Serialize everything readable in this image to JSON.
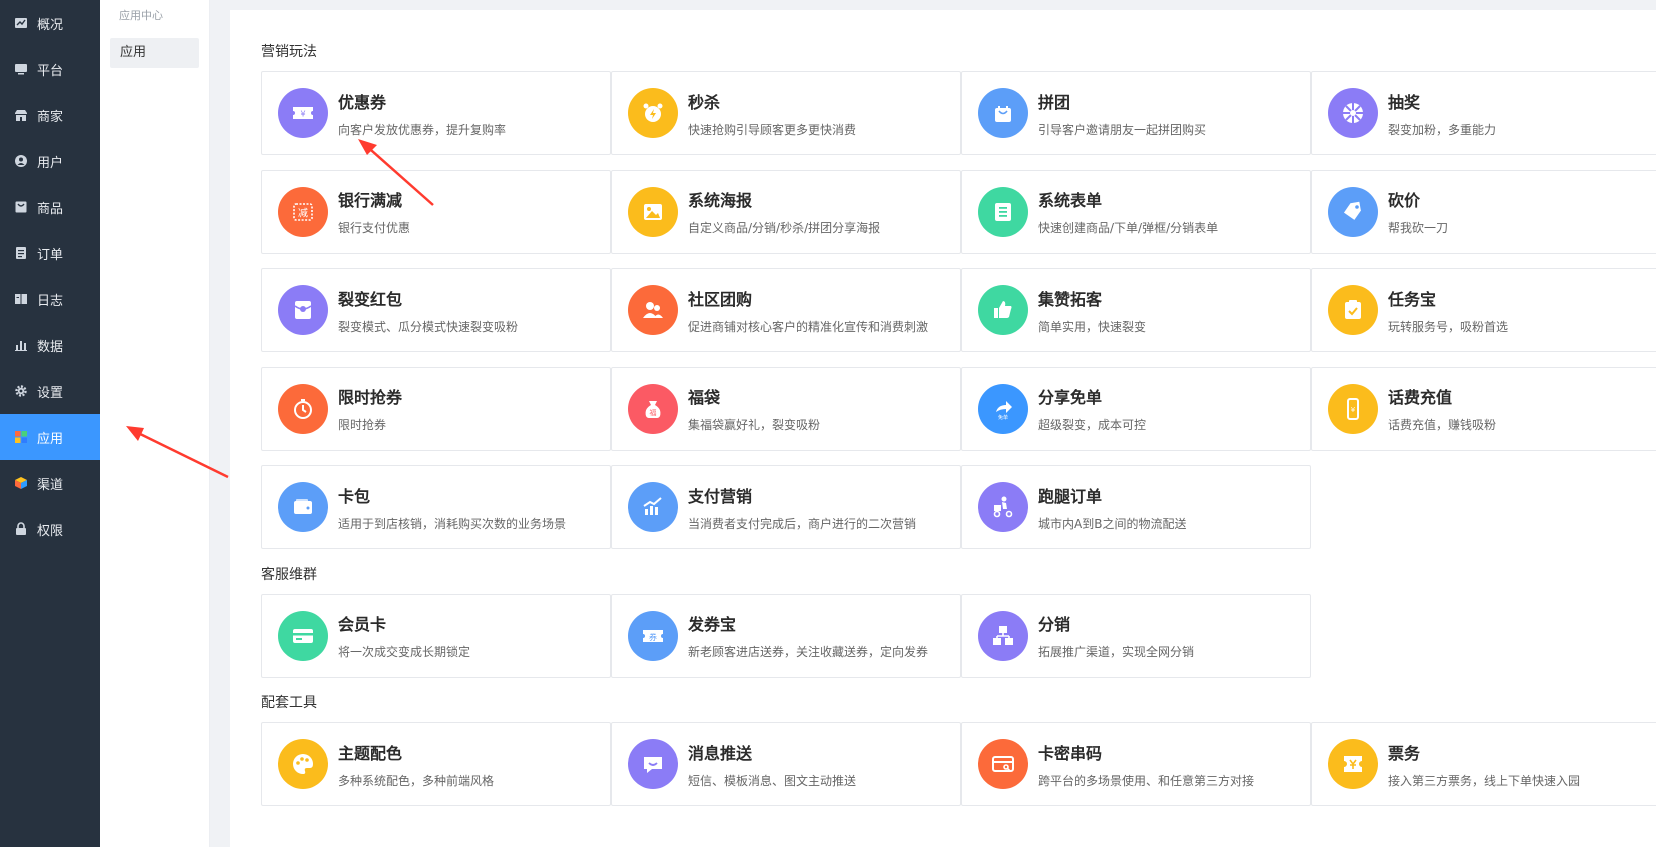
{
  "nav": {
    "items": [
      {
        "label": "概况",
        "icon": "overview-icon"
      },
      {
        "label": "平台",
        "icon": "platform-icon"
      },
      {
        "label": "商家",
        "icon": "store-icon"
      },
      {
        "label": "用户",
        "icon": "user-icon"
      },
      {
        "label": "商品",
        "icon": "goods-icon"
      },
      {
        "label": "订单",
        "icon": "order-icon"
      },
      {
        "label": "日志",
        "icon": "log-icon"
      },
      {
        "label": "数据",
        "icon": "data-icon"
      },
      {
        "label": "设置",
        "icon": "gear-icon"
      },
      {
        "label": "应用",
        "icon": "apps-icon"
      },
      {
        "label": "渠道",
        "icon": "channel-icon"
      },
      {
        "label": "权限",
        "icon": "lock-icon"
      }
    ],
    "active_index": 9
  },
  "subnav": {
    "title": "应用中心",
    "items": [
      {
        "label": "应用"
      }
    ]
  },
  "colors": {
    "sidebar_bg": "#27323f",
    "active": "#3b97ff"
  },
  "sections": [
    {
      "title": "营销玩法",
      "cards": [
        {
          "name": "优惠券",
          "desc": "向客户发放优惠券，提升复购率",
          "color": "#8b7cf6",
          "icon": "coupon-icon"
        },
        {
          "name": "秒杀",
          "desc": "快速抢购引导顾客更多更快消费",
          "color": "#fbbc1c",
          "icon": "alarm-clock-icon"
        },
        {
          "name": "拼团",
          "desc": "引导客户邀请朋友一起拼团购买",
          "color": "#5c9ef8",
          "icon": "shopping-bag-icon"
        },
        {
          "name": "抽奖",
          "desc": "裂变加粉，多重能力",
          "color": "#8b7cf6",
          "icon": "wheel-icon"
        },
        {
          "name": "银行满减",
          "desc": "银行支付优惠",
          "color": "#fc6a3a",
          "icon": "discount-icon"
        },
        {
          "name": "系统海报",
          "desc": "自定义商品/分销/秒杀/拼团分享海报",
          "color": "#fbbc1c",
          "icon": "poster-icon"
        },
        {
          "name": "系统表单",
          "desc": "快速创建商品/下单/弹框/分销表单",
          "color": "#3fd8a1",
          "icon": "form-icon"
        },
        {
          "name": "砍价",
          "desc": "帮我砍一刀",
          "color": "#5c9ef8",
          "icon": "price-tag-icon"
        },
        {
          "name": "裂变红包",
          "desc": "裂变模式、瓜分模式快速裂变吸粉",
          "color": "#8b7cf6",
          "icon": "red-packet-icon"
        },
        {
          "name": "社区团购",
          "desc": "促进商铺对核心客户的精准化宣传和消费刺激",
          "color": "#fc6a3a",
          "icon": "group-icon"
        },
        {
          "name": "集赞拓客",
          "desc": "简单实用，快速裂变",
          "color": "#3fd8a1",
          "icon": "thumbs-up-icon"
        },
        {
          "name": "任务宝",
          "desc": "玩转服务号，吸粉首选",
          "color": "#fbbc1c",
          "icon": "clipboard-check-icon"
        },
        {
          "name": "限时抢券",
          "desc": "限时抢券",
          "color": "#fc6a3a",
          "icon": "stopwatch-icon"
        },
        {
          "name": "福袋",
          "desc": "集福袋赢好礼，裂变吸粉",
          "color": "#fb5a64",
          "icon": "lucky-bag-icon"
        },
        {
          "name": "分享免单",
          "desc": "超级裂变，成本可控",
          "color": "#3b97ff",
          "icon": "share-icon"
        },
        {
          "name": "话费充值",
          "desc": "话费充值，赚钱吸粉",
          "color": "#fbbc1c",
          "icon": "phone-recharge-icon"
        },
        {
          "name": "卡包",
          "desc": "适用于到店核销，消耗购买次数的业务场景",
          "color": "#5c9ef8",
          "icon": "wallet-icon"
        },
        {
          "name": "支付营销",
          "desc": "当消费者支付完成后，商户进行的二次营销",
          "color": "#5c9ef8",
          "icon": "chart-up-icon"
        },
        {
          "name": "跑腿订单",
          "desc": "城市内A到B之间的物流配送",
          "color": "#8b7cf6",
          "icon": "courier-icon"
        }
      ]
    },
    {
      "title": "客服维群",
      "cards": [
        {
          "name": "会员卡",
          "desc": "将一次成交变成长期锁定",
          "color": "#3fd8a1",
          "icon": "member-card-icon"
        },
        {
          "name": "发券宝",
          "desc": "新老顾客进店送券，关注收藏送券，定向发券",
          "color": "#5c9ef8",
          "icon": "ticket-icon"
        },
        {
          "name": "分销",
          "desc": "拓展推广渠道，实现全网分销",
          "color": "#8b7cf6",
          "icon": "hierarchy-icon"
        }
      ]
    },
    {
      "title": "配套工具",
      "cards": [
        {
          "name": "主题配色",
          "desc": "多种系统配色，多种前端风格",
          "color": "#fbbc1c",
          "icon": "palette-icon"
        },
        {
          "name": "消息推送",
          "desc": "短信、模板消息、图文主动推送",
          "color": "#8b7cf6",
          "icon": "message-icon"
        },
        {
          "name": "卡密串码",
          "desc": "跨平台的多场景使用、和任意第三方对接",
          "color": "#fc6a3a",
          "icon": "card-key-icon"
        },
        {
          "name": "票务",
          "desc": "接入第三方票务，线上下单快速入园",
          "color": "#fbbc1c",
          "icon": "ticket-stub-icon"
        }
      ]
    }
  ]
}
